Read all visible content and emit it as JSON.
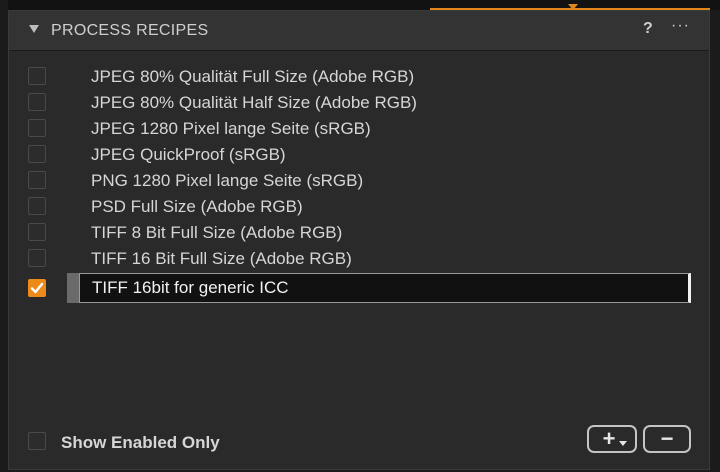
{
  "panel": {
    "title": "PROCESS RECIPES",
    "help_label": "?",
    "more_label": "···"
  },
  "recipes": [
    {
      "label": "JPEG 80% Qualität Full Size (Adobe RGB)",
      "checked": false
    },
    {
      "label": "JPEG 80% Qualität Half Size (Adobe RGB)",
      "checked": false
    },
    {
      "label": "JPEG 1280 Pixel lange Seite (sRGB)",
      "checked": false
    },
    {
      "label": "JPEG QuickProof (sRGB)",
      "checked": false
    },
    {
      "label": "PNG 1280 Pixel lange Seite (sRGB)",
      "checked": false
    },
    {
      "label": "PSD Full Size (Adobe RGB)",
      "checked": false
    },
    {
      "label": "TIFF 8 Bit Full Size (Adobe RGB)",
      "checked": false
    },
    {
      "label": "TIFF 16 Bit Full Size (Adobe RGB)",
      "checked": false
    },
    {
      "label": "TIFF 16bit for generic ICC",
      "checked": true,
      "editing": true
    }
  ],
  "footer": {
    "show_enabled_only_label": "Show Enabled Only",
    "show_enabled_only_checked": false,
    "add_label": "+",
    "remove_label": "−"
  },
  "colors": {
    "accent": "#ee8a1a",
    "panel_bg": "#2a2a2a",
    "text": "#d6d6d6"
  }
}
